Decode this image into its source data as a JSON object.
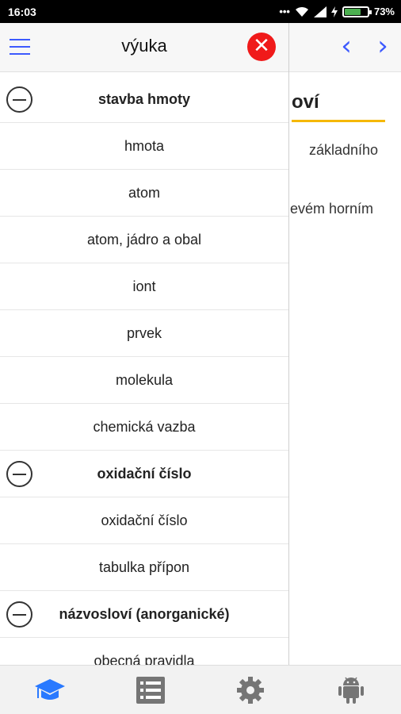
{
  "status_bar": {
    "time": "16:03",
    "dots": "•••",
    "battery_percent": "73%",
    "battery_level": 0.73
  },
  "background": {
    "heading_fragment": "oví",
    "line1_fragment": "základního",
    "line2_fragment": "evém  horním",
    "prev_icon": "chevron-left-icon",
    "next_icon": "chevron-right-icon",
    "accent_color": "#3d5afe",
    "underline_color": "#f5b800"
  },
  "drawer": {
    "title": "výuka",
    "close_symbol": "✕",
    "sections": [
      {
        "title": "stavba hmoty",
        "items": [
          "hmota",
          "atom",
          "atom, jádro a obal",
          "iont",
          "prvek",
          "molekula",
          "chemická vazba"
        ]
      },
      {
        "title": "oxidační číslo",
        "items": [
          "oxidační číslo",
          "tabulka přípon"
        ]
      },
      {
        "title": "názvosloví (anorganické)",
        "items": [
          "obecná pravidla"
        ]
      }
    ]
  },
  "tabbar": {
    "tabs": [
      {
        "icon": "graduation-cap-icon",
        "active": true
      },
      {
        "icon": "list-icon",
        "active": false
      },
      {
        "icon": "gear-icon",
        "active": false
      },
      {
        "icon": "android-icon",
        "active": false
      }
    ],
    "active_color": "#2979ff",
    "inactive_color": "#757575"
  }
}
